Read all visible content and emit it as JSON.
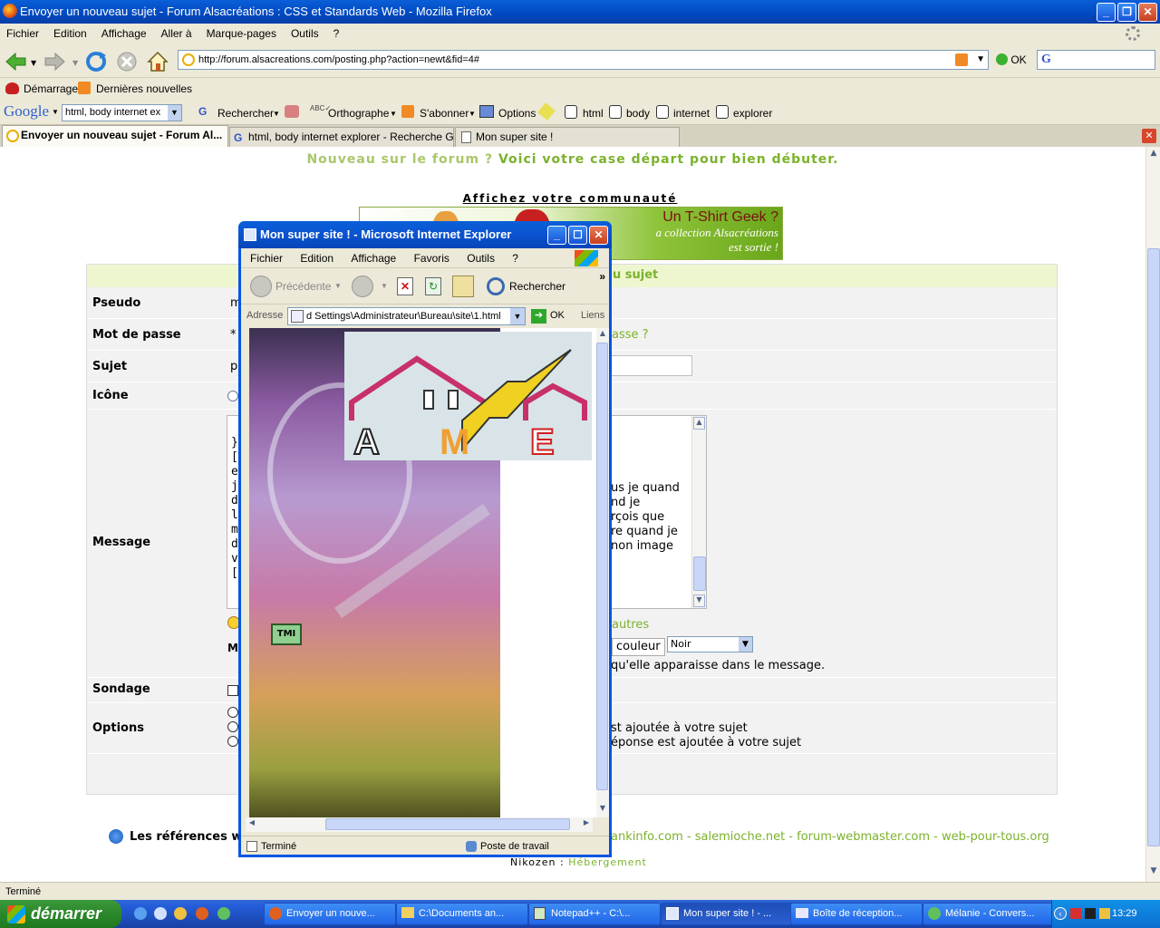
{
  "firefox": {
    "title": "Envoyer un nouveau sujet - Forum Alsacréations : CSS et Standards Web - Mozilla Firefox",
    "menu": [
      "Fichier",
      "Edition",
      "Affichage",
      "Aller à",
      "Marque-pages",
      "Outils",
      "?"
    ],
    "url": "http://forum.alsacreations.com/posting.php?action=newt&fid=4#",
    "go_label": "OK",
    "bookmarks": [
      "Démarrage",
      "Dernières nouvelles"
    ],
    "google_bar": {
      "logo": "Google",
      "query": "html, body internet ex",
      "items": [
        "Rechercher",
        "Orthographe",
        "S'abonner",
        "Options",
        "html",
        "body",
        "internet",
        "explorer"
      ]
    },
    "tabs": [
      "Envoyer un nouveau sujet - Forum Al...",
      "html, body internet explorer - Recherche G...",
      "Mon super site !"
    ],
    "status": "Terminé"
  },
  "forum": {
    "welcome_a": "Nouveau sur le forum ?",
    "welcome_b": "Voici votre case départ pour bien débuter.",
    "community": "Affichez votre communauté",
    "banner_title": "Un T-Shirt Geek ?",
    "banner_sub1": "a collection Alsacréations",
    "banner_sub2": "est sortie !",
    "header_partial": "u sujet",
    "labels": {
      "pseudo": "Pseudo",
      "password": "Mot de passe",
      "subject": "Sujet",
      "icon": "Icône",
      "message": "Message",
      "poll": "Sondage",
      "options": "Options"
    },
    "pseudo_partial": "m",
    "password_partial": "*",
    "subject_partial": "p",
    "forgot_partial": "asse ?",
    "message_left": [
      "}",
      "[/",
      "",
      "e",
      "je",
      "d",
      "l'i",
      "m",
      "d",
      "v",
      "[u"
    ],
    "message_right": [
      "us je quand",
      "nd je",
      "rçois que",
      "re quand je",
      "non image"
    ],
    "others_partial": "autres",
    "color_button": "couleur",
    "color_value": "Noir",
    "message_hint_partial": "qu'elle apparaisse dans le message.",
    "m_partial": "M",
    "option1_partial": "st ajoutée à votre sujet",
    "option2_partial": "éponse est ajoutée à votre sujet",
    "refs_label": "Les références we",
    "refs_links": "ankinfo.com - salemioche.net - forum-webmaster.com - web-pour-tous.org",
    "hosting_a": "Nikozen :",
    "hosting_b": "Hébergement"
  },
  "ie": {
    "title": "Mon super site ! - Microsoft Internet Explorer",
    "menu": [
      "Fichier",
      "Edition",
      "Affichage",
      "Favoris",
      "Outils",
      "?"
    ],
    "back": "Précédente",
    "search": "Rechercher",
    "address_label": "Adresse",
    "address": "d Settings\\Administrateur\\Bureau\\site\\1.html",
    "go": "OK",
    "links": "Liens",
    "status_left": "Terminé",
    "status_right": "Poste de travail",
    "logo_letters": [
      "A",
      "M",
      "E"
    ],
    "badge": "TMI"
  },
  "taskbar": {
    "start": "démarrer",
    "buttons": [
      "Envoyer un nouve...",
      "C:\\Documents an...",
      "Notepad++ - C:\\...",
      "Mon super site ! - ...",
      "Boîte de réception...",
      "Mélanie - Convers..."
    ],
    "clock": "13:29"
  }
}
